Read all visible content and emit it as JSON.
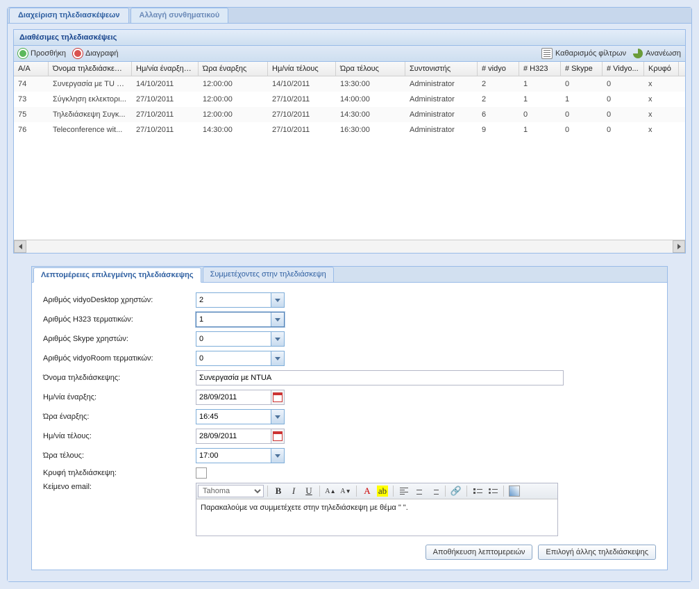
{
  "mainTabs": {
    "active": "Διαχείριση τηλεδιασκέψεων",
    "other": "Αλλαγή συνθηματικού"
  },
  "gridTitle": "Διαθέσιμες τηλεδιασκέψεις",
  "toolbar": {
    "add": "Προσθήκη",
    "del": "Διαγραφή",
    "clear": "Καθαρισμός φίλτρων",
    "refresh": "Ανανέωση"
  },
  "cols": {
    "aa": "Α/Α",
    "name": "Όνομα τηλεδιάσκεψης",
    "sd": "Ημ/νία έναρξης",
    "st": "Ώρα έναρξης",
    "ed": "Ημ/νία τέλους",
    "et": "Ώρα τέλους",
    "co": "Συντονιστής",
    "vi": "# vidyo",
    "h3": "# H323",
    "sk": "# Skype",
    "vr": "# Vidyo...",
    "hid": "Κρυφό"
  },
  "rows": [
    {
      "aa": "74",
      "name": "Συνεργασία με TU B...",
      "sd": "14/10/2011",
      "st": "12:00:00",
      "ed": "14/10/2011",
      "et": "13:30:00",
      "co": "Administrator",
      "vi": "2",
      "h3": "1",
      "sk": "0",
      "vr": "0",
      "hid": "x"
    },
    {
      "aa": "73",
      "name": "Σύγκληση εκλεκτορι...",
      "sd": "27/10/2011",
      "st": "12:00:00",
      "ed": "27/10/2011",
      "et": "14:00:00",
      "co": "Administrator",
      "vi": "2",
      "h3": "1",
      "sk": "1",
      "vr": "0",
      "hid": "x"
    },
    {
      "aa": "75",
      "name": "Τηλεδιάσκεψη Συγκ...",
      "sd": "27/10/2011",
      "st": "12:00:00",
      "ed": "27/10/2011",
      "et": "14:30:00",
      "co": "Administrator",
      "vi": "6",
      "h3": "0",
      "sk": "0",
      "vr": "0",
      "hid": "x"
    },
    {
      "aa": "76",
      "name": "Teleconference wit...",
      "sd": "27/10/2011",
      "st": "14:30:00",
      "ed": "27/10/2011",
      "et": "16:30:00",
      "co": "Administrator",
      "vi": "9",
      "h3": "1",
      "sk": "0",
      "vr": "0",
      "hid": "x"
    }
  ],
  "detailTabs": {
    "active": "Λεπτομέρειες επιλεγμένης τηλεδιάσκεψης",
    "other": "Συμμετέχοντες στην τηλεδιάσκεψη"
  },
  "form": {
    "lbl_vd": "Αριθμός vidyoDesktop χρηστών:",
    "val_vd": "2",
    "lbl_h3": "Αριθμός H323 τερματικών:",
    "val_h3": "1",
    "lbl_sk": "Αριθμός Skype χρηστών:",
    "val_sk": "0",
    "lbl_vr": "Αριθμός vidyoRoom τερματικών:",
    "val_vr": "0",
    "lbl_name": "Όνομα τηλεδιάσκεψης:",
    "val_name": "Συνεργασία με NTUA",
    "lbl_sd": "Ημ/νία έναρξης:",
    "val_sd": "28/09/2011",
    "lbl_st": "Ώρα έναρξης:",
    "val_st": "16:45",
    "lbl_ed": "Ημ/νία τέλους:",
    "val_ed": "28/09/2011",
    "lbl_et": "Ώρα τέλους:",
    "val_et": "17:00",
    "lbl_hid": "Κρυφή τηλεδιάσκεψη:",
    "lbl_email": "Κείμενο email:",
    "email_body": "Παρακαλούμε να συμμετέχετε στην τηλεδιάσκεψη με θέμα \" \".",
    "font": "Tahoma"
  },
  "buttons": {
    "save": "Αποθήκευση λεπτομερειών",
    "pick": "Επιλογή άλλης τηλεδιάσκεψης"
  }
}
